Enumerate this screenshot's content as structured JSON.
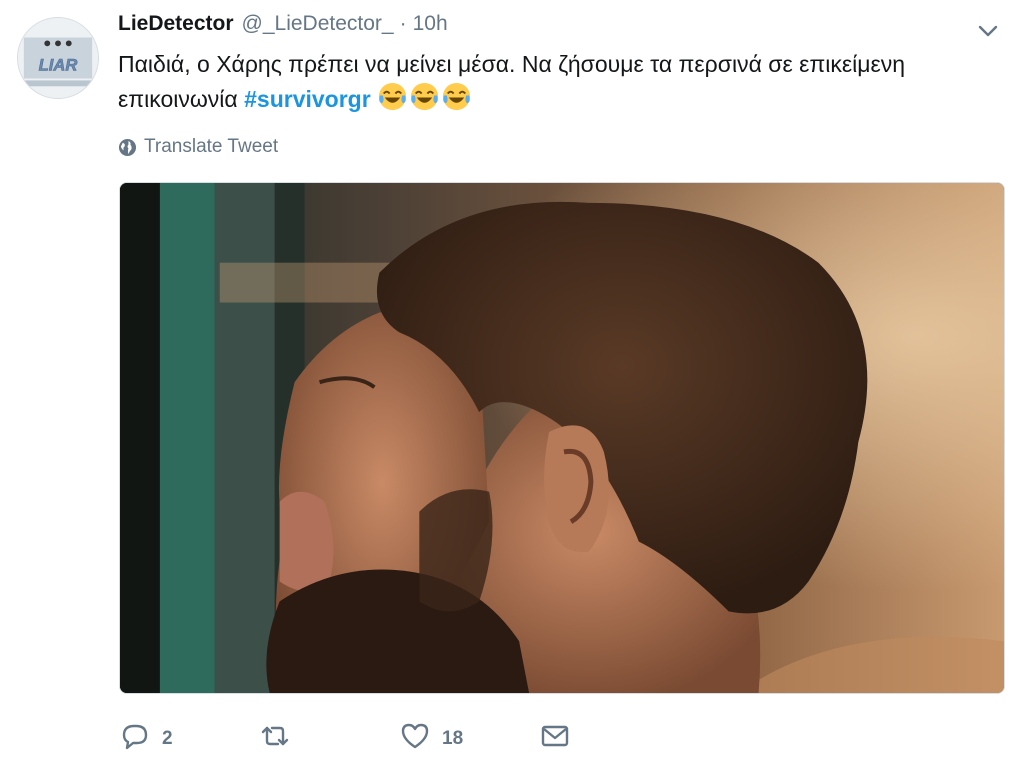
{
  "tweet": {
    "display_name": "LieDetector",
    "handle": "@_LieDetector_",
    "separator": "·",
    "time": "10h",
    "avatar": {
      "label": "LIAR",
      "icon": "liar-logo"
    },
    "text_part1": "Παιδιά, ο Χάρης πρέπει να μείνει μέσα. Να ζήσουμε τα περσινά σε επικείμενη επικοινωνία ",
    "hashtag": "#survivorgr",
    "emoji": [
      "tears-of-joy",
      "tears-of-joy",
      "tears-of-joy"
    ],
    "translate_label": "Translate Tweet",
    "media": {
      "description_icon": "video-still"
    },
    "actions": {
      "reply_count": "2",
      "retweet_count": "",
      "like_count": "18"
    }
  },
  "colors": {
    "link": "#1b95e0",
    "secondary": "#657786",
    "text": "#14171a"
  }
}
